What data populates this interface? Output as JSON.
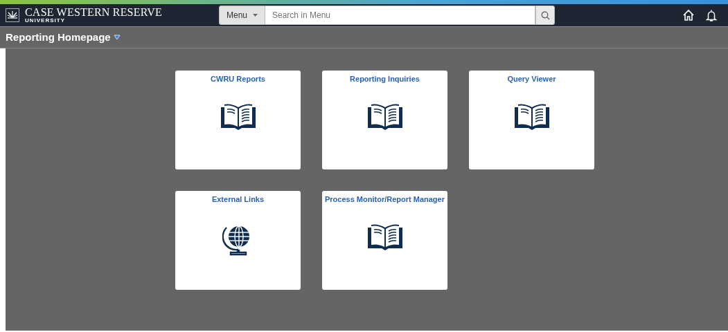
{
  "header": {
    "logo_title": "CASE WESTERN RESERVE",
    "logo_subtitle": "UNIVERSITY",
    "menu_button": "Menu",
    "search": {
      "placeholder": "Search in Menu"
    }
  },
  "page_title": "Reporting Homepage",
  "tiles": [
    {
      "title": "CWRU Reports",
      "kind": "book"
    },
    {
      "title": "Reporting Inquiries",
      "kind": "book"
    },
    {
      "title": "Query Viewer",
      "kind": "book"
    },
    {
      "title": "External Links",
      "kind": "globe"
    },
    {
      "title": "Process Monitor/Report Manager",
      "kind": "book"
    }
  ]
}
